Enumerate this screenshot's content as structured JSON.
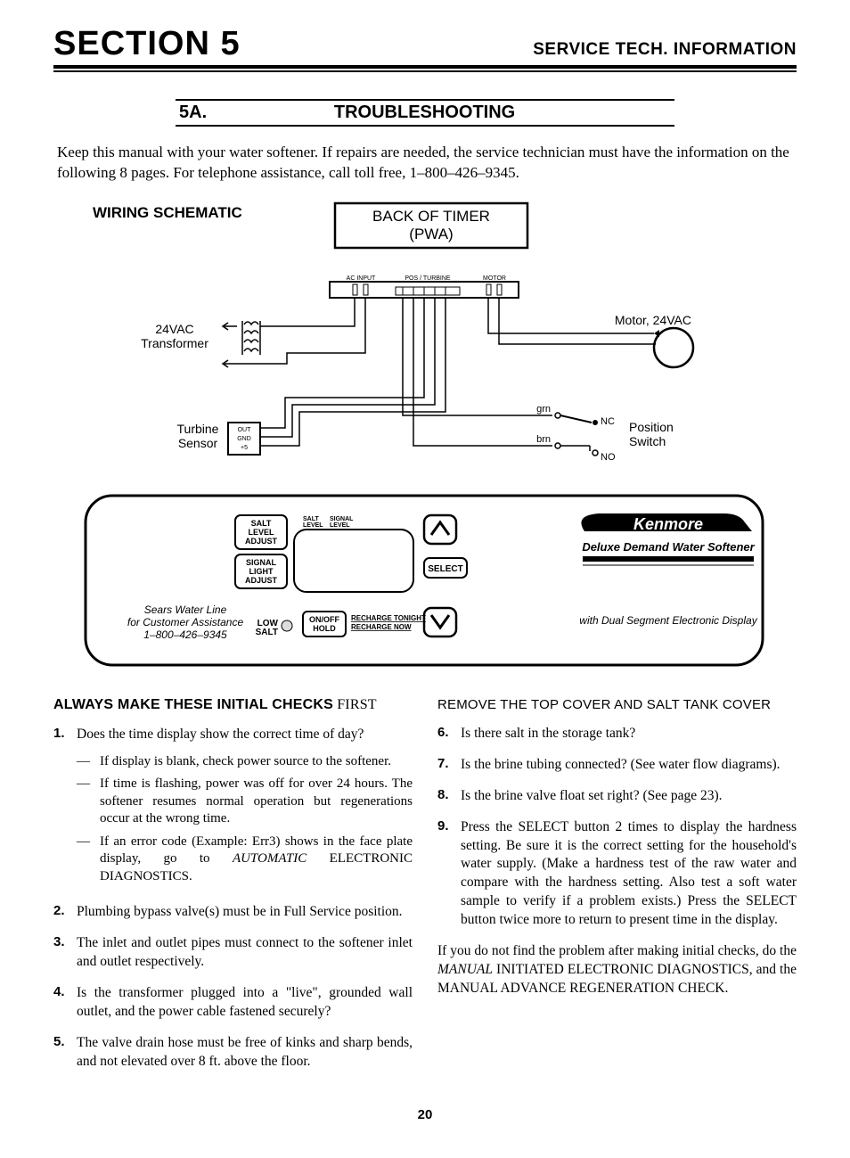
{
  "header": {
    "section": "SECTION 5",
    "right": "SERVICE TECH. INFORMATION"
  },
  "subhead": {
    "num": "5A.",
    "title": "TROUBLESHOOTING"
  },
  "intro": "Keep this manual with your water softener. If repairs are needed, the service technician must have the information on the following 8 pages. For telephone assistance, call toll free, 1–800–426–9345.",
  "wiring": {
    "title": "WIRING SCHEMATIC",
    "timer_box": "BACK OF TIMER (PWA)",
    "ac_input": "AC INPUT",
    "pos_turbine": "POS / TURBINE",
    "motor_hdr": "MOTOR",
    "transformer": "24VAC Transformer",
    "motor_lbl": "Motor, 24VAC",
    "turbine_sensor": "Turbine Sensor",
    "turbine_pins_out": "OUT",
    "turbine_pins_gnd": "GND",
    "turbine_pins_5": "+5",
    "grn": "grn",
    "brn": "brn",
    "nc": "NC",
    "no": "NO",
    "pos_switch": "Position Switch"
  },
  "panel": {
    "salt_level_adjust": "SALT LEVEL ADJUST",
    "signal_light_adjust": "SIGNAL LIGHT ADJUST",
    "salt_level": "SALT LEVEL",
    "signal_level": "SIGNAL LEVEL",
    "select": "SELECT",
    "onoff_hold": "ON/OFF HOLD",
    "recharge_tonight": "RECHARGE TONIGHT",
    "recharge_now": "RECHARGE NOW",
    "low_salt": "LOW SALT",
    "sears_line1": "Sears Water Line",
    "sears_line2": "for Customer Assistance",
    "sears_line3": "1–800–426–9345",
    "brand": "Kenmore",
    "subtitle": "Deluxe Demand Water Softener",
    "desc": "with Dual Segment Electronic Display"
  },
  "col_left": {
    "heading_strong": "ALWAYS MAKE THESE INITIAL CHECKS",
    "heading_light": " FIRST",
    "items": [
      {
        "n": "1.",
        "t": "Does the time display show the correct time of day?",
        "subs": [
          "If display is blank, check power source to the softener.",
          "If time is flashing, power was off for over 24 hours. The softener resumes normal operation but regenerations occur at the wrong time.",
          "If an error code (Example: Err3) shows in the face plate display, go to AUTOMATIC ELECTRONIC DIAGNOSTICS."
        ]
      },
      {
        "n": "2.",
        "t": "Plumbing bypass valve(s) must be in Full Service position."
      },
      {
        "n": "3.",
        "t": "The inlet and outlet pipes must connect to the softener inlet and outlet respectively."
      },
      {
        "n": "4.",
        "t": "Is the transformer plugged into a \"live\", grounded wall outlet, and the power cable fastened securely?"
      },
      {
        "n": "5.",
        "t": "The valve drain hose must be free of kinks and sharp bends, and not elevated over 8 ft. above the floor."
      }
    ]
  },
  "col_right": {
    "heading": "REMOVE THE TOP COVER AND SALT TANK COVER",
    "items": [
      {
        "n": "6.",
        "t": "Is there salt in the storage tank?"
      },
      {
        "n": "7.",
        "t": "Is the brine tubing connected? (See water flow diagrams)."
      },
      {
        "n": "8.",
        "t": "Is the brine valve float set right? (See page 23)."
      },
      {
        "n": "9.",
        "t": "Press the SELECT button 2 times to display the hardness setting. Be sure it is the correct setting for the household's water supply. (Make a hardness test of the raw water and compare with the hardness setting. Also test a soft water sample to verify if a problem exists.) Press the SELECT button twice more to return to present time in the display."
      }
    ],
    "closing": "If you do not find the problem after making initial checks, do the MANUAL INITIATED ELECTRONIC DIAGNOSTICS, and the MANUAL ADVANCE REGENERATION CHECK."
  },
  "page_num": "20"
}
